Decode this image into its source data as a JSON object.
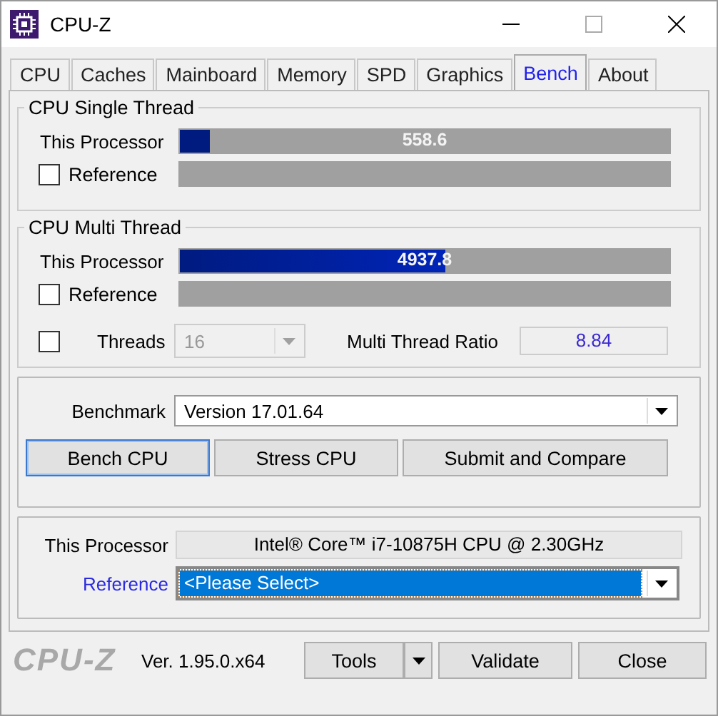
{
  "window": {
    "title": "CPU-Z"
  },
  "tabs": [
    {
      "label": "CPU",
      "selected": false
    },
    {
      "label": "Caches",
      "selected": false
    },
    {
      "label": "Mainboard",
      "selected": false
    },
    {
      "label": "Memory",
      "selected": false
    },
    {
      "label": "SPD",
      "selected": false
    },
    {
      "label": "Graphics",
      "selected": false
    },
    {
      "label": "Bench",
      "selected": true
    },
    {
      "label": "About",
      "selected": false
    }
  ],
  "single_thread": {
    "title": "CPU Single Thread",
    "this_label": "This Processor",
    "this_bar": {
      "level": 0.06,
      "reading": "558.6"
    },
    "reference_label": "Reference",
    "reference_checked": false
  },
  "multi_thread": {
    "title": "CPU Multi Thread",
    "this_label": "This Processor",
    "this_bar": {
      "level": 0.54,
      "reading": "4937.8"
    },
    "reference_label": "Reference",
    "reference_checked": false,
    "threads_checked": false,
    "threads_label": "Threads",
    "threads_value": "16",
    "threads_disabled": true,
    "ratio_label": "Multi Thread Ratio",
    "ratio_value": "8.84"
  },
  "benchmark": {
    "label": "Benchmark",
    "value": "Version 17.01.64",
    "buttons": [
      "Bench CPU",
      "Stress CPU",
      "Submit and Compare"
    ]
  },
  "compare": {
    "processor_label": "This Processor",
    "processor_value": "Intel® Core™ i7-10875H CPU @ 2.30GHz",
    "reference_label": "Reference",
    "reference_value": "<Please Select>",
    "reference_selected": true
  },
  "footer": {
    "logo": "CPU-Z",
    "version": "Ver. 1.95.0.x64",
    "tools": "Tools",
    "validate": "Validate",
    "close": "Close"
  }
}
